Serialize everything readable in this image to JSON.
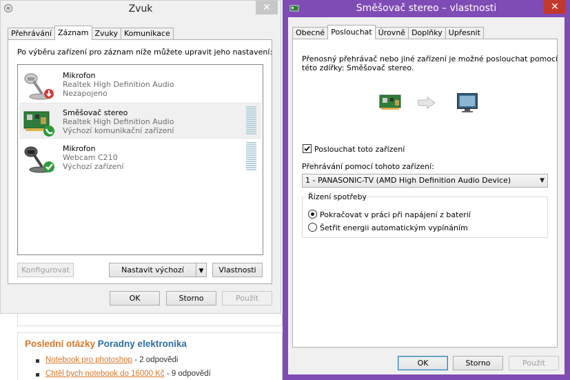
{
  "webpage": {
    "heading_part1": "Poslední otázky",
    "heading_part2": "Poradny elektronika",
    "items": [
      {
        "link": "Notebook pro photoshop",
        "suffix": " - 2 odpovědi"
      },
      {
        "link": "Chtěl bych notebook do 16000 Kč",
        "suffix": " - 9 odpovědí"
      }
    ]
  },
  "zvuk": {
    "title": "Zvuk",
    "tabs": [
      "Přehrávání",
      "Záznam",
      "Zvuky",
      "Komunikace"
    ],
    "active_tab": "Záznam",
    "instructions": "Po výběru zařízení pro záznam níže můžete upravit jeho nastavení:",
    "devices": [
      {
        "name": "Mikrofon",
        "driver": "Realtek High Definition Audio",
        "status": "Nezapojeno",
        "icon": "microphone-icon",
        "badge": "unplugged-badge-icon",
        "selected": false
      },
      {
        "name": "Směšovač stereo",
        "driver": "Realtek High Definition Audio",
        "status": "Výchozí komunikační zařízení",
        "icon": "sound-card-icon",
        "badge": "phone-badge-icon",
        "selected": true
      },
      {
        "name": "Mikrofon",
        "driver": "Webcam C210",
        "status": "Výchozí zařízení",
        "icon": "microphone-icon",
        "badge": "checkmark-badge-icon",
        "selected": false
      }
    ],
    "buttons": {
      "configure": "Konfigurovat",
      "set_default": "Nastavit výchozí",
      "properties": "Vlastnosti",
      "ok": "OK",
      "cancel": "Storno",
      "apply": "Použít"
    }
  },
  "mixer_props": {
    "title": "Směšovač stereo – vlastnosti",
    "tabs": [
      "Obecné",
      "Poslouchat",
      "Úrovně",
      "Doplňky",
      "Upřesnit"
    ],
    "active_tab": "Poslouchat",
    "description_line1": "Přenosný přehrávač nebo jiné zařízení je možné poslouchat pomocí",
    "description_line2": "této zdířky: Směšovač stereo.",
    "listen_checkbox_label": "Poslouchat toto zařízení",
    "listen_checked": true,
    "playback_label": "Přehrávání pomocí tohoto zařízení:",
    "playback_device": "1 - PANASONIC-TV  (AMD High Definition Audio Device)",
    "power_group_label": "Řízení spotřeby",
    "power_options": [
      {
        "label": "Pokračovat v práci při napájení z baterií",
        "selected": true
      },
      {
        "label": "Šetřit energii automatickým vypínáním",
        "selected": false
      }
    ],
    "buttons": {
      "ok": "OK",
      "cancel": "Storno",
      "apply": "Použít"
    }
  },
  "colors": {
    "accent_window": "#7f4bb5",
    "link_orange": "#d9762a",
    "heading_blue": "#2d6da4"
  }
}
